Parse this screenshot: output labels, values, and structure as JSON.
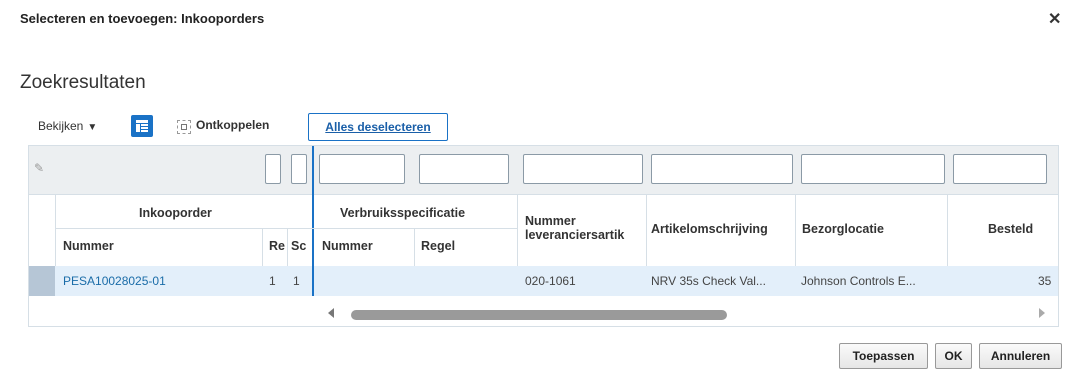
{
  "dialog": {
    "title": "Selecteren en toevoegen: Inkooporders"
  },
  "icons": {
    "close": "close-icon",
    "freeze": "freeze-columns-icon",
    "detach": "detach-icon",
    "edit": "pencil-icon"
  },
  "section": {
    "title": "Zoekresultaten"
  },
  "toolbar": {
    "view_label": "Bekijken",
    "detach_label": "Ontkoppelen",
    "deselect_label": "Alles deselecteren"
  },
  "grid": {
    "group_headers": {
      "purchase_order": "Inkooporder",
      "consumption_spec": "Verbruiksspecificatie"
    },
    "columns": {
      "number": "Nummer",
      "revision": "Re",
      "schedule": "Sc",
      "spec_number": "Nummer",
      "line": "Regel",
      "supplier_item": "Nummer leveranciersartik",
      "item_description": "Artikelomschrijving",
      "location": "Bezorglocatie",
      "ordered": "Besteld"
    },
    "rows": [
      {
        "number": "PESA10028025-01",
        "revision": "1",
        "schedule": "1",
        "spec_number": "",
        "line": "",
        "supplier_item": "020-1061",
        "item_description": "NRV 35s Check Val...",
        "location": "Johnson Controls E...",
        "ordered": "35"
      }
    ]
  },
  "buttons": {
    "apply": "Toepassen",
    "ok": "OK",
    "cancel": "Annuleren"
  },
  "colors": {
    "accent": "#1a72c6",
    "selected_row": "#e3effa",
    "link": "#1a6ca8"
  }
}
